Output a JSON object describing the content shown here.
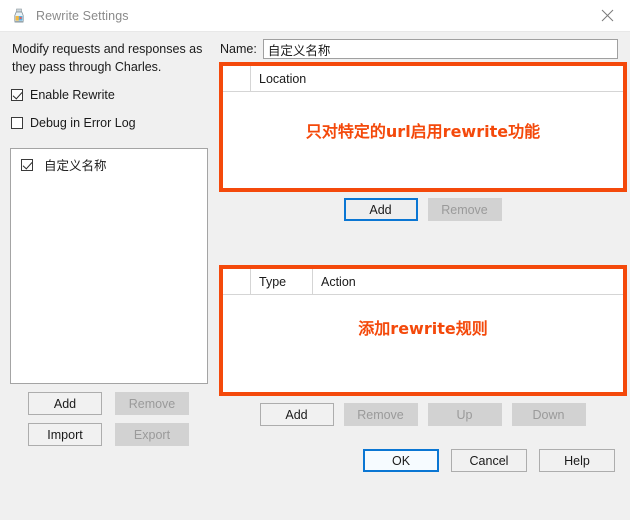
{
  "window": {
    "title": "Rewrite Settings",
    "icon": "charles-bottle-icon",
    "close_label": "✕"
  },
  "left_panel": {
    "description": "Modify requests and responses as they pass through Charles.",
    "checkboxes": [
      {
        "label": "Enable Rewrite",
        "checked": true
      },
      {
        "label": "Debug in Error Log",
        "checked": false
      }
    ],
    "set_list": {
      "items": [
        {
          "label": "自定义名称",
          "checked": true
        }
      ]
    },
    "buttons": [
      {
        "label": "Add",
        "enabled": true
      },
      {
        "label": "Remove",
        "enabled": false
      },
      {
        "label": "Import",
        "enabled": true
      },
      {
        "label": "Export",
        "enabled": false
      }
    ]
  },
  "right_panel": {
    "name_label": "Name:",
    "name_value": "自定义名称",
    "name_placeholder": "",
    "location_table": {
      "columns": [
        "",
        "Location"
      ],
      "rows": [],
      "annotation": "只对特定的url启用rewrite功能"
    },
    "location_buttons": [
      {
        "label": "Add",
        "enabled": true,
        "focused": true
      },
      {
        "label": "Remove",
        "enabled": false
      }
    ],
    "rule_table": {
      "columns": [
        "",
        "Type",
        "Action"
      ],
      "rows": [],
      "annotation": "添加rewrite规则"
    },
    "rule_buttons": [
      {
        "label": "Add",
        "enabled": true
      },
      {
        "label": "Remove",
        "enabled": false
      },
      {
        "label": "Up",
        "enabled": false
      },
      {
        "label": "Down",
        "enabled": false
      }
    ]
  },
  "dialog_buttons": [
    {
      "label": "OK",
      "enabled": true,
      "default": true
    },
    {
      "label": "Cancel",
      "enabled": true
    },
    {
      "label": "Help",
      "enabled": true
    }
  ],
  "colors": {
    "annotation": "#f4490b",
    "focus": "#0a76d3",
    "window_bg": "#f0f0f0",
    "field_bg": "#ffffff"
  }
}
